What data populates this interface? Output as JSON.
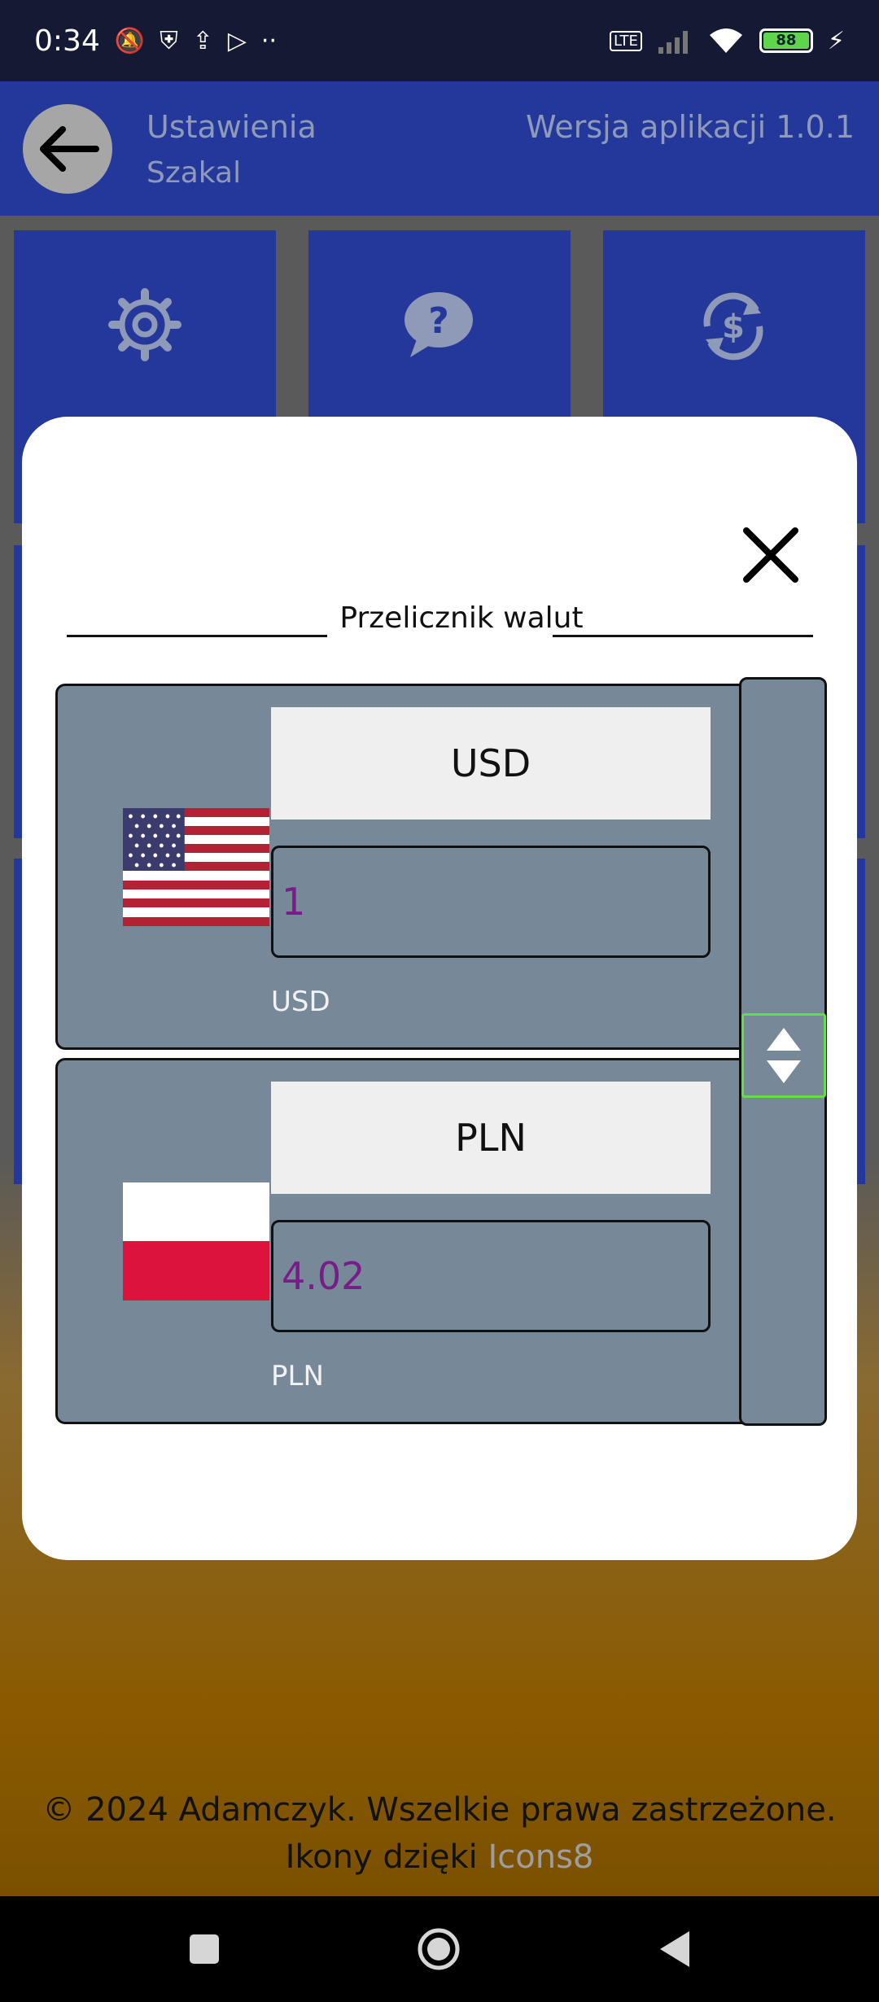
{
  "status_bar": {
    "time": "0:34",
    "left_icons": [
      "mute-icon",
      "shield-icon",
      "upload-icon",
      "play-icon",
      "more-icon"
    ],
    "right_icons": [
      "volte-icon",
      "signal-icon",
      "wifi-icon",
      "battery-icon"
    ],
    "battery": "88"
  },
  "header": {
    "title": "Ustawienia",
    "subtitle": "Szakal",
    "version": "Wersja aplikacji 1.0.1"
  },
  "tiles": [
    "gear-icon",
    "help-icon",
    "currency-exchange-icon"
  ],
  "modal": {
    "title": "Przelicznik walut",
    "from": {
      "currency": "USD",
      "amount": "1",
      "label": "USD",
      "flag": "us-flag-icon"
    },
    "to": {
      "currency": "PLN",
      "amount": "4.02",
      "label": "PLN",
      "flag": "pl-flag-icon"
    }
  },
  "footer": {
    "copyright": "© 2024 Adamczyk. Wszelkie prawa zastrzeżone.",
    "icons_prefix": "Ikony dzięki",
    "icons_link": "Icons8"
  },
  "colors": {
    "header_bg": "#23389a",
    "card_bg": "#778899",
    "amount_text": "#7a1b8a",
    "swap_border": "#66dd44"
  }
}
